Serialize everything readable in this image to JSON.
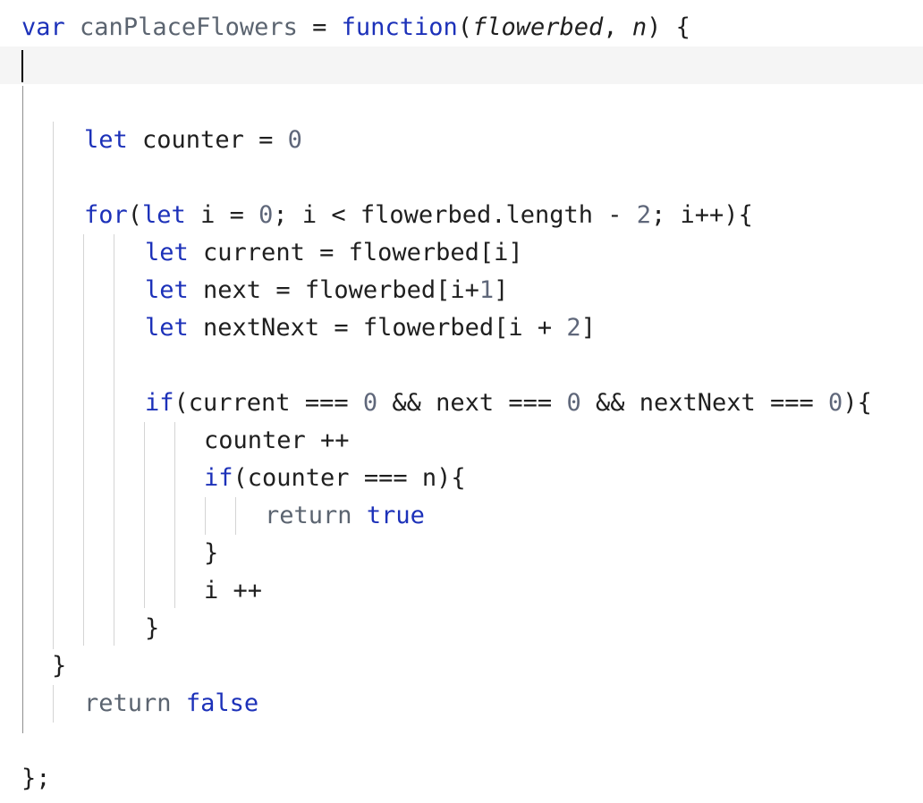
{
  "editor": {
    "language": "javascript",
    "cursor_line": 2,
    "colors": {
      "keyword": "#1c31b9",
      "number": "#5f677a",
      "text": "#1f1f1f",
      "current_line_bg": "#f5f5f5",
      "indent_guide": "#d4d4d4"
    },
    "lines": [
      {
        "tokens": [
          {
            "text": "var",
            "type": "kw"
          },
          {
            "text": " ",
            "type": "plain"
          },
          {
            "text": "canPlaceFlowers",
            "type": "ident"
          },
          {
            "text": " = ",
            "type": "plain"
          },
          {
            "text": "function",
            "type": "kw"
          },
          {
            "text": "(",
            "type": "plain"
          },
          {
            "text": "flowerbed",
            "type": "param"
          },
          {
            "text": ", ",
            "type": "plain"
          },
          {
            "text": "n",
            "type": "param"
          },
          {
            "text": ") {",
            "type": "plain"
          }
        ]
      },
      {
        "tokens": []
      },
      {
        "tokens": []
      },
      {
        "tokens": [
          {
            "text": "let",
            "type": "kw"
          },
          {
            "text": " counter = ",
            "type": "plain"
          },
          {
            "text": "0",
            "type": "num"
          }
        ]
      },
      {
        "tokens": []
      },
      {
        "tokens": [
          {
            "text": "for",
            "type": "kw"
          },
          {
            "text": "(",
            "type": "plain"
          },
          {
            "text": "let",
            "type": "kw"
          },
          {
            "text": " i = ",
            "type": "plain"
          },
          {
            "text": "0",
            "type": "num"
          },
          {
            "text": "; i < flowerbed.length - ",
            "type": "plain"
          },
          {
            "text": "2",
            "type": "num"
          },
          {
            "text": "; i++){",
            "type": "plain"
          }
        ]
      },
      {
        "tokens": [
          {
            "text": "let",
            "type": "kw"
          },
          {
            "text": " current = flowerbed[i]",
            "type": "plain"
          }
        ]
      },
      {
        "tokens": [
          {
            "text": "let",
            "type": "kw"
          },
          {
            "text": " next = flowerbed[i+",
            "type": "plain"
          },
          {
            "text": "1",
            "type": "num"
          },
          {
            "text": "]",
            "type": "plain"
          }
        ]
      },
      {
        "tokens": [
          {
            "text": "let",
            "type": "kw"
          },
          {
            "text": " nextNext = flowerbed[i + ",
            "type": "plain"
          },
          {
            "text": "2",
            "type": "num"
          },
          {
            "text": "]",
            "type": "plain"
          }
        ]
      },
      {
        "tokens": []
      },
      {
        "tokens": [
          {
            "text": "if",
            "type": "kw"
          },
          {
            "text": "(current === ",
            "type": "plain"
          },
          {
            "text": "0",
            "type": "num"
          },
          {
            "text": " && next === ",
            "type": "plain"
          },
          {
            "text": "0",
            "type": "num"
          },
          {
            "text": " && nextNext === ",
            "type": "plain"
          },
          {
            "text": "0",
            "type": "num"
          },
          {
            "text": "){",
            "type": "plain"
          }
        ]
      },
      {
        "tokens": [
          {
            "text": "counter ++",
            "type": "plain"
          }
        ]
      },
      {
        "tokens": [
          {
            "text": "if",
            "type": "kw"
          },
          {
            "text": "(counter === n){",
            "type": "plain"
          }
        ]
      },
      {
        "tokens": [
          {
            "text": "return",
            "type": "ident"
          },
          {
            "text": " ",
            "type": "plain"
          },
          {
            "text": "true",
            "type": "kw"
          }
        ]
      },
      {
        "tokens": [
          {
            "text": "}",
            "type": "plain"
          }
        ]
      },
      {
        "tokens": [
          {
            "text": "i ++",
            "type": "plain"
          }
        ]
      },
      {
        "tokens": [
          {
            "text": "}",
            "type": "plain"
          }
        ]
      },
      {
        "tokens": [
          {
            "text": "}",
            "type": "plain"
          }
        ]
      },
      {
        "tokens": [
          {
            "text": "return",
            "type": "ident"
          },
          {
            "text": " ",
            "type": "plain"
          },
          {
            "text": "false",
            "type": "kw"
          }
        ]
      },
      {
        "tokens": []
      },
      {
        "tokens": [
          {
            "text": "};",
            "type": "plain"
          }
        ]
      }
    ]
  }
}
